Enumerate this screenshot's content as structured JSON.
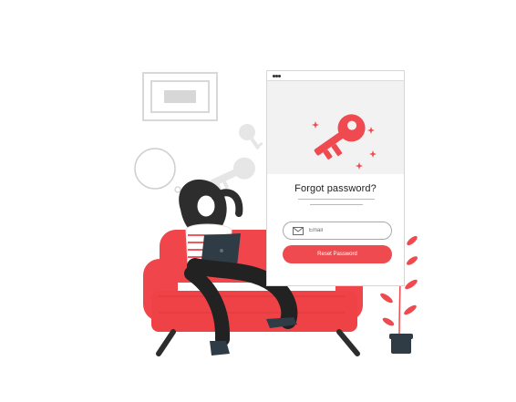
{
  "card": {
    "title": "Forgot password?",
    "email_placeholder": "Email",
    "reset_label": "Reset Password"
  },
  "colors": {
    "accent": "#ef4a4f",
    "sofa": "#f0464b",
    "dark": "#2d2d2d",
    "shadow": "#f2f2f2"
  },
  "icons": {
    "window_dots": "window-dots-icon",
    "key": "key-icon",
    "email": "mail-icon"
  }
}
